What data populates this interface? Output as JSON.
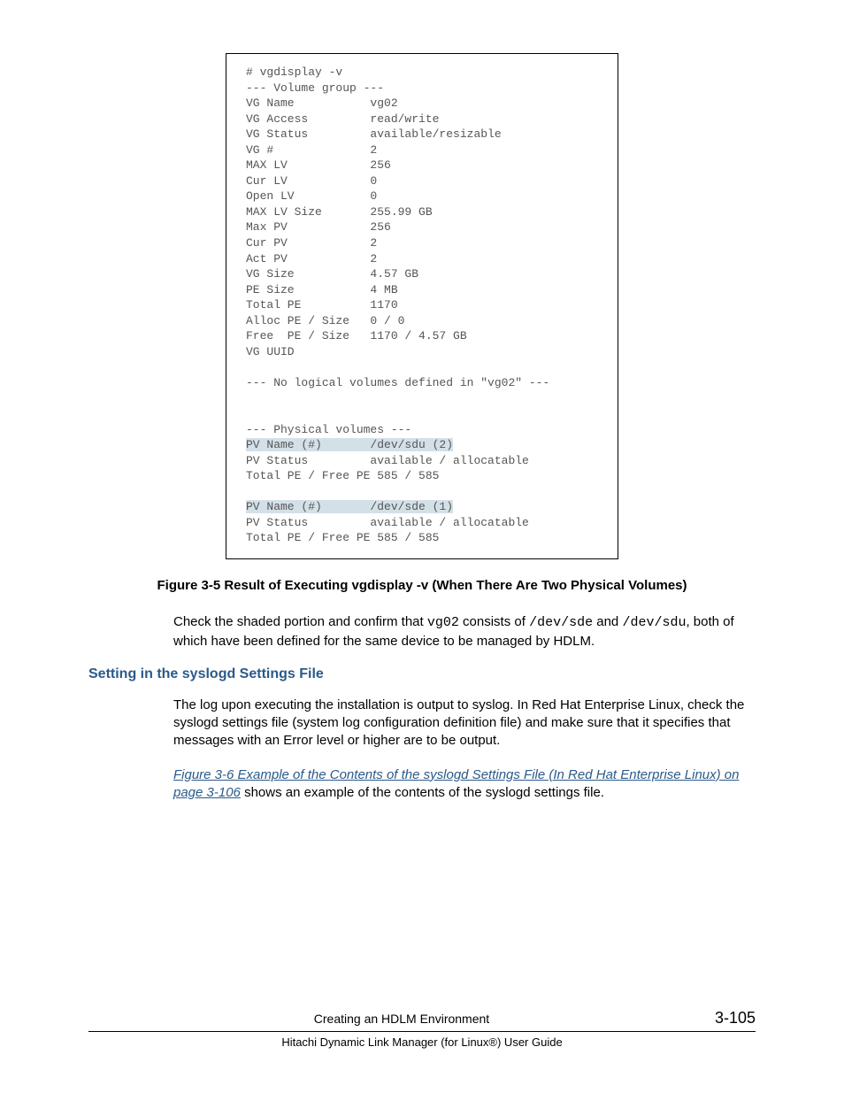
{
  "terminal": {
    "cmd": "# vgdisplay -v",
    "vg_header": "--- Volume group ---",
    "fields": [
      {
        "k": "VG Name",
        "v": "vg02"
      },
      {
        "k": "VG Access",
        "v": "read/write"
      },
      {
        "k": "VG Status",
        "v": "available/resizable"
      },
      {
        "k": "VG #",
        "v": "2"
      },
      {
        "k": "MAX LV",
        "v": "256"
      },
      {
        "k": "Cur LV",
        "v": "0"
      },
      {
        "k": "Open LV",
        "v": "0"
      },
      {
        "k": "MAX LV Size",
        "v": "255.99 GB"
      },
      {
        "k": "Max PV",
        "v": "256"
      },
      {
        "k": "Cur PV",
        "v": "2"
      },
      {
        "k": "Act PV",
        "v": "2"
      },
      {
        "k": "VG Size",
        "v": "4.57 GB"
      },
      {
        "k": "PE Size",
        "v": "4 MB"
      },
      {
        "k": "Total PE",
        "v": "1170"
      },
      {
        "k": "Alloc PE / Size",
        "v": "0 / 0"
      },
      {
        "k": "Free  PE / Size",
        "v": "1170 / 4.57 GB"
      },
      {
        "k": "VG UUID",
        "v": ""
      }
    ],
    "no_lv": "--- No logical volumes defined in \"vg02\" ---",
    "pv_header": "--- Physical volumes ---",
    "pv1": {
      "name_k": "PV Name (#)",
      "name_v": "/dev/sdu (2)",
      "status_k": "PV Status",
      "status_v": "available / allocatable",
      "totals": "Total PE / Free PE 585 / 585"
    },
    "pv2": {
      "name_k": "PV Name (#)",
      "name_v": "/dev/sde (1)",
      "status_k": "PV Status",
      "status_v": "available / allocatable",
      "totals": "Total PE / Free PE 585 / 585"
    }
  },
  "figure_caption": "Figure 3-5 Result of Executing vgdisplay -v (When There Are Two Physical Volumes)",
  "para1": {
    "t1": "Check the shaded portion and confirm that ",
    "code1": "vg02",
    "t2": " consists of ",
    "code2": "/dev/sde",
    "t3": " and ",
    "code3": "/dev/sdu",
    "t4": ", both of which have been defined for the same device to be managed by HDLM."
  },
  "section_heading": "Setting in the syslogd Settings File",
  "para2": "The log upon executing the installation is output to syslog. In Red Hat Enterprise Linux, check the syslogd settings file (system log configuration definition file) and make sure that it specifies that messages with an Error level or higher are to be output.",
  "para3": {
    "xref": "Figure 3-6 Example of the Contents of the syslogd Settings File (In Red Hat Enterprise Linux) on page 3-106",
    "rest": " shows an example of the contents of the syslogd settings file."
  },
  "footer": {
    "chapter": "Creating an HDLM Environment",
    "pageno": "3-105",
    "book": "Hitachi Dynamic Link Manager (for Linux®) User Guide"
  }
}
